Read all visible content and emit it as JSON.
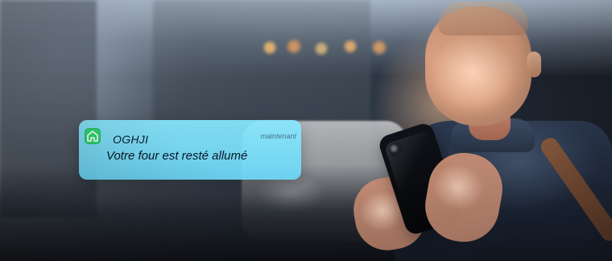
{
  "notification": {
    "app_name": "OGHJI",
    "time": "maintenant",
    "message": "Votre four est resté allumé",
    "icon": "home-icon"
  },
  "colors": {
    "notification_bg": "#7CE1FA",
    "app_icon_bg": "#2DD16E"
  }
}
